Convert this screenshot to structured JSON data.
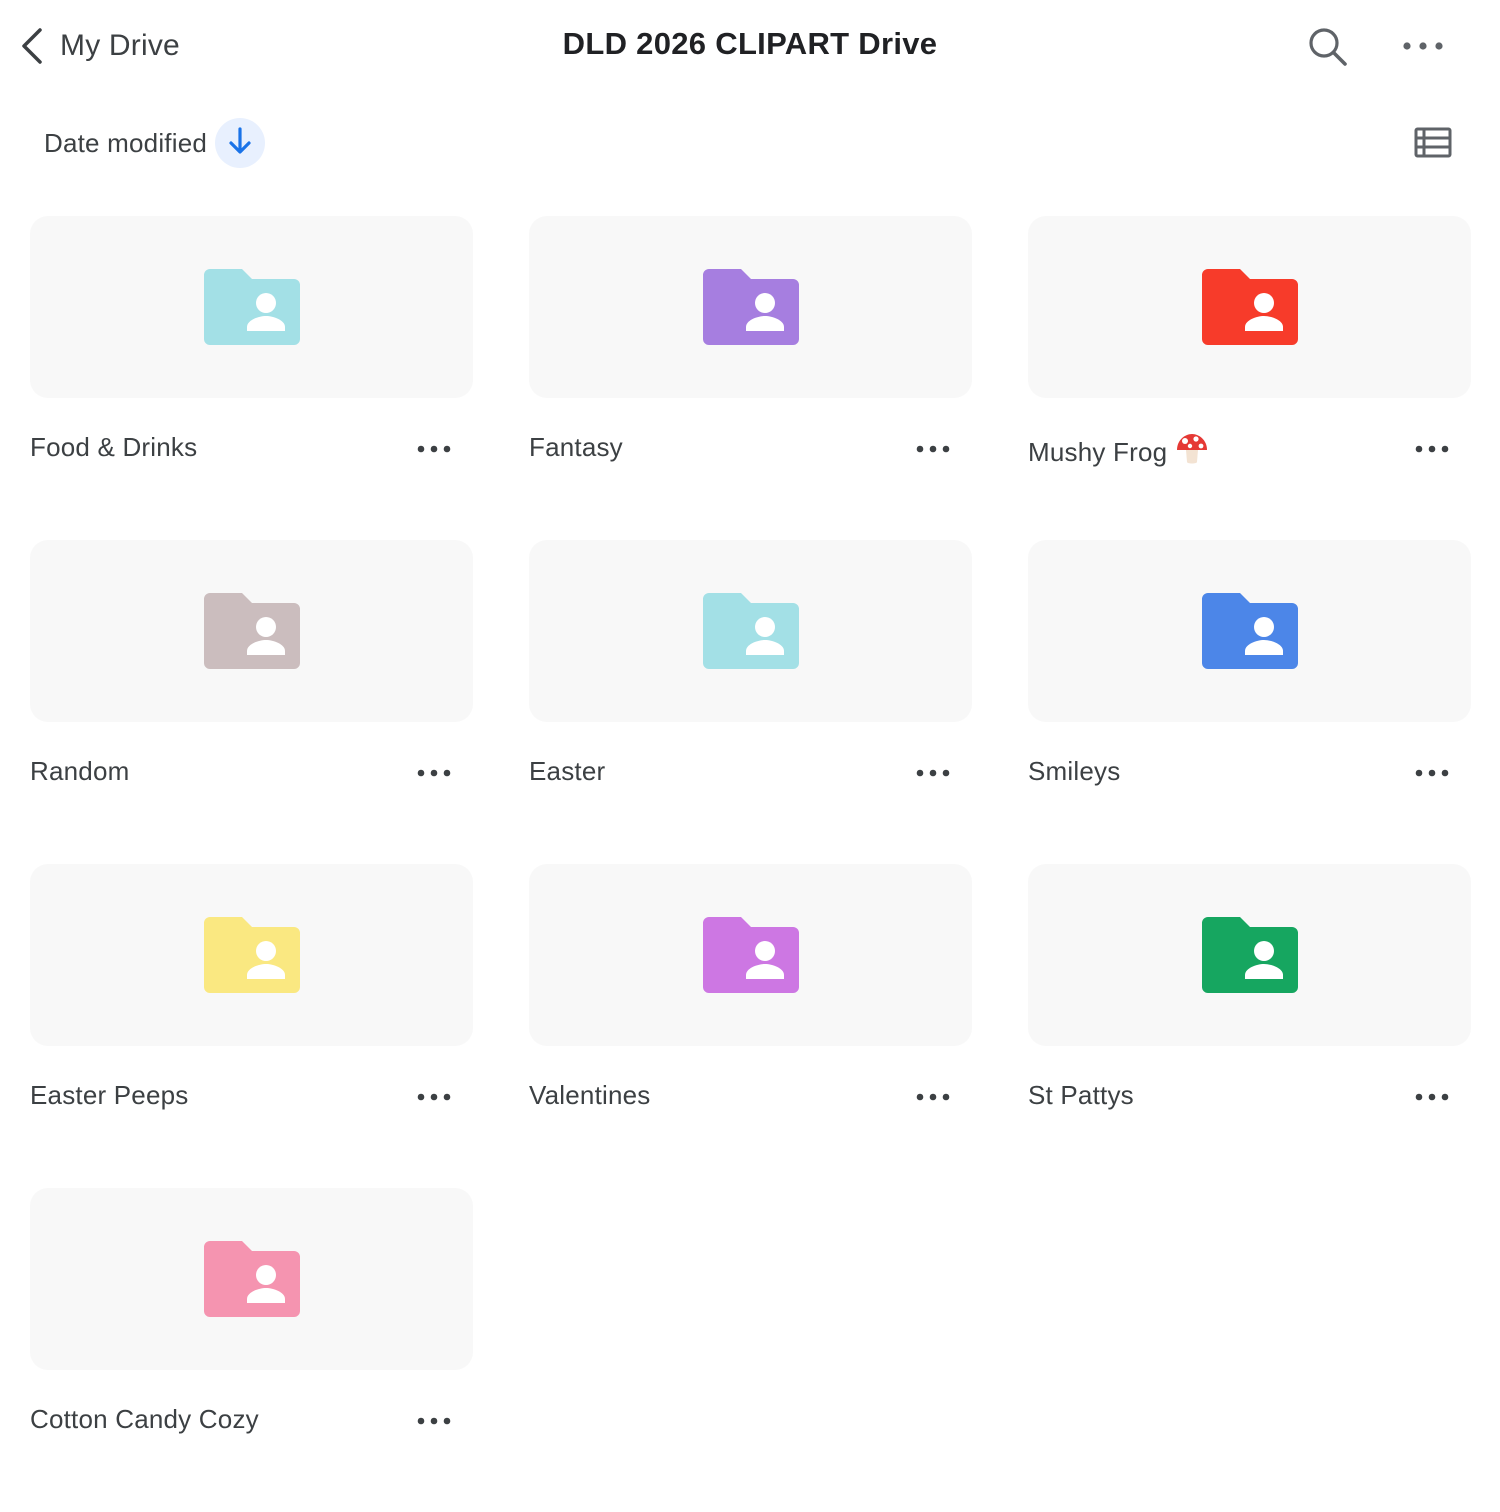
{
  "header": {
    "back_label": "My Drive",
    "title": "DLD 2026 CLIPART Drive",
    "icons": {
      "back": "chevron-left-icon",
      "search": "search-icon",
      "more": "more-horizontal-icon"
    }
  },
  "sort": {
    "label": "Date modified",
    "direction": "descending",
    "direction_icon": "arrow-down-icon"
  },
  "view_toggle_icon": "list-view-icon",
  "folders": [
    {
      "name": "Food & Drinks",
      "color": "#a3e0e6",
      "icon": "shared-folder-icon"
    },
    {
      "name": "Fantasy",
      "color": "#a67ee0",
      "icon": "shared-folder-icon"
    },
    {
      "name": "Mushy Frog",
      "color": "#f73b2a",
      "icon": "shared-folder-icon",
      "emoji": "mushroom-icon"
    },
    {
      "name": "Random",
      "color": "#cbbdbe",
      "icon": "shared-folder-icon"
    },
    {
      "name": "Easter",
      "color": "#a3e0e6",
      "icon": "shared-folder-icon"
    },
    {
      "name": "Smileys",
      "color": "#4c86e8",
      "icon": "shared-folder-icon"
    },
    {
      "name": "Easter Peeps",
      "color": "#fae881",
      "icon": "shared-folder-icon"
    },
    {
      "name": "Valentines",
      "color": "#cd77e3",
      "icon": "shared-folder-icon"
    },
    {
      "name": "St Pattys",
      "color": "#16a660",
      "icon": "shared-folder-icon"
    },
    {
      "name": "Cotton Candy Cozy",
      "color": "#f594b0",
      "icon": "shared-folder-icon"
    }
  ],
  "colors": {
    "accent": "#1a73e8",
    "sort_chip_bg": "#e8f0fe",
    "tile_bg": "#f8f8f8",
    "text": "#3c4043"
  }
}
